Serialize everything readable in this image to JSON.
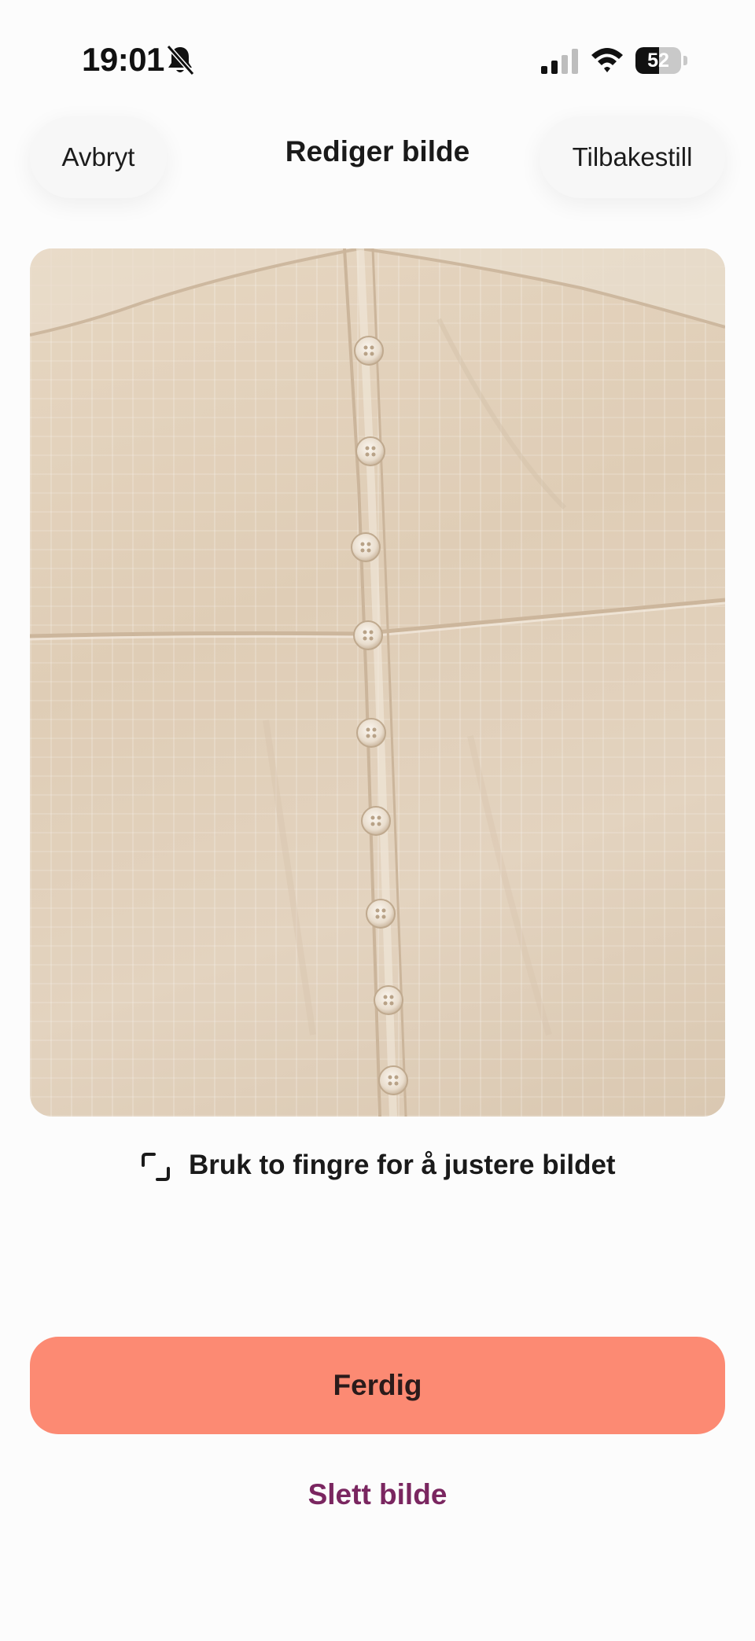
{
  "status_bar": {
    "time": "19:01",
    "battery_level": "52",
    "battery_fraction": 0.52,
    "silent_mode_icon": "bell-slash-icon",
    "signal_icon": "cellular-signal-icon",
    "wifi_icon": "wifi-icon"
  },
  "header": {
    "cancel_label": "Avbryt",
    "title": "Rediger bilde",
    "reset_label": "Tilbakestill"
  },
  "editor": {
    "image_subject": "beige-button-blouse-photo",
    "hint_icon": "crop-frame-icon",
    "hint_text": "Bruk to fingre for å justere bildet"
  },
  "actions": {
    "done_label": "Ferdig",
    "delete_label": "Slett bilde"
  },
  "colors": {
    "primary_button": "#fc8a73",
    "delete_link": "#7a2660",
    "background": "#fcfcfc"
  }
}
